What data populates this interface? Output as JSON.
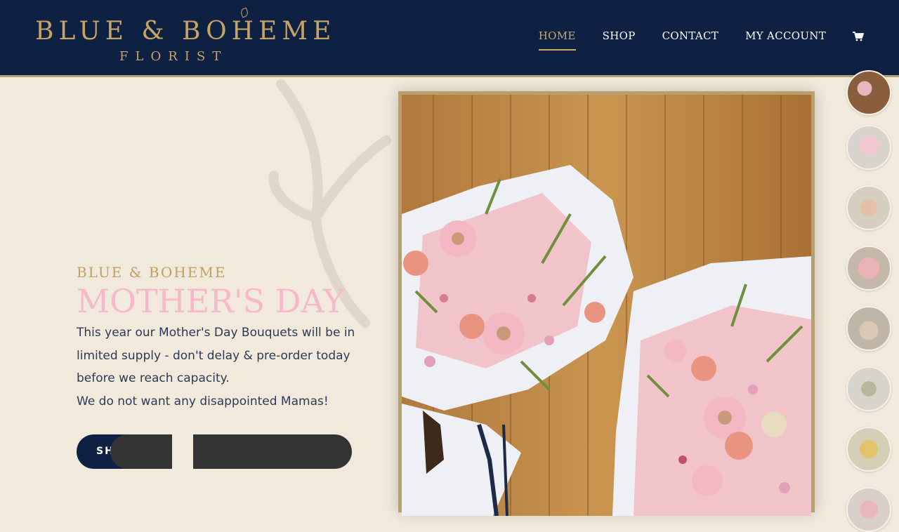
{
  "brand": {
    "name": "BLUE & BOHEME",
    "tagline": "FLORIST"
  },
  "nav": {
    "items": [
      {
        "label": "HOME",
        "active": true
      },
      {
        "label": "SHOP",
        "active": false
      },
      {
        "label": "CONTACT",
        "active": false
      },
      {
        "label": "MY ACCOUNT",
        "active": false
      }
    ],
    "cart_icon": "shopping-cart-icon"
  },
  "hero": {
    "eyebrow": "BLUE & BOHEME",
    "title": "MOTHER'S DAY",
    "body_line_1": "This year our Mother's Day Bouquets will be in limited supply - don't delay & pre-order today before we reach capacity.",
    "body_line_2": "We do not want any disappointed Mamas!",
    "primary_button_visible_text": "SH",
    "image_alt": "Two pink and white flower bouquets wrapped in paper against a wooden wall"
  },
  "colors": {
    "navy": "#0f2143",
    "gold": "#c6a465",
    "cream": "#f1e9db",
    "pink_title": "#f7b8c9",
    "body_text": "#2d3a55",
    "dark_overlay": "#333333"
  },
  "gallery": {
    "thumbnail_count": 8
  }
}
